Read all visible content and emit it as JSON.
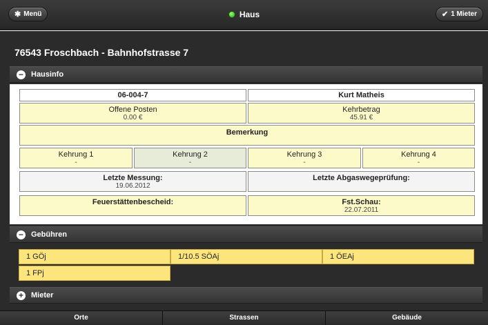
{
  "header": {
    "menu_label": "Menü",
    "menu_icon": "gear-icon",
    "title": "Haus",
    "status_color": "#3fbf2a",
    "tenant_label": "1 Mieter",
    "tenant_icon": "checkmark-icon"
  },
  "page": {
    "title": "76543 Froschbach - Bahnhofstrasse 7"
  },
  "sections": {
    "hausinfo": {
      "label": "Hausinfo",
      "state": "expanded"
    },
    "gebuehren": {
      "label": "Gebühren",
      "state": "expanded"
    },
    "mieter": {
      "label": "Mieter",
      "state": "collapsed"
    }
  },
  "hausinfo": {
    "id": "06-004-7",
    "owner": "Kurt Matheis",
    "offene_posten_label": "Offene Posten",
    "offene_posten_value": "0.00 €",
    "kehrbetrag_label": "Kehrbetrag",
    "kehrbetrag_value": "45.91 €",
    "bemerkung_label": "Bemerkung",
    "kehrungen": [
      {
        "label": "Kehrung 1",
        "value": "-"
      },
      {
        "label": "Kehrung 2",
        "value": "-"
      },
      {
        "label": "Kehrung 3",
        "value": "-"
      },
      {
        "label": "Kehrung 4",
        "value": "-"
      }
    ],
    "letzte_messung_label": "Letzte Messung:",
    "letzte_messung_value": "19.06.2012",
    "abgaswege_label": "Letzte Abgaswegeprüfung:",
    "feuerstaetten_label": "Feuerstättenbescheid:",
    "fstschau_label": "Fst.Schau:",
    "fstschau_value": "22.07.2011"
  },
  "gebuehren": {
    "items": [
      "1 GÖj",
      "1/10.5 SÖAj",
      "1 ÖEAj",
      "1 FPj"
    ]
  },
  "footer": {
    "tabs": [
      "Orte",
      "Strassen",
      "Gebäude"
    ]
  },
  "colors": {
    "accent_yellow": "#fdfac9",
    "fee_yellow": "#fde57e",
    "dark_bg": "#2b2b2b"
  }
}
